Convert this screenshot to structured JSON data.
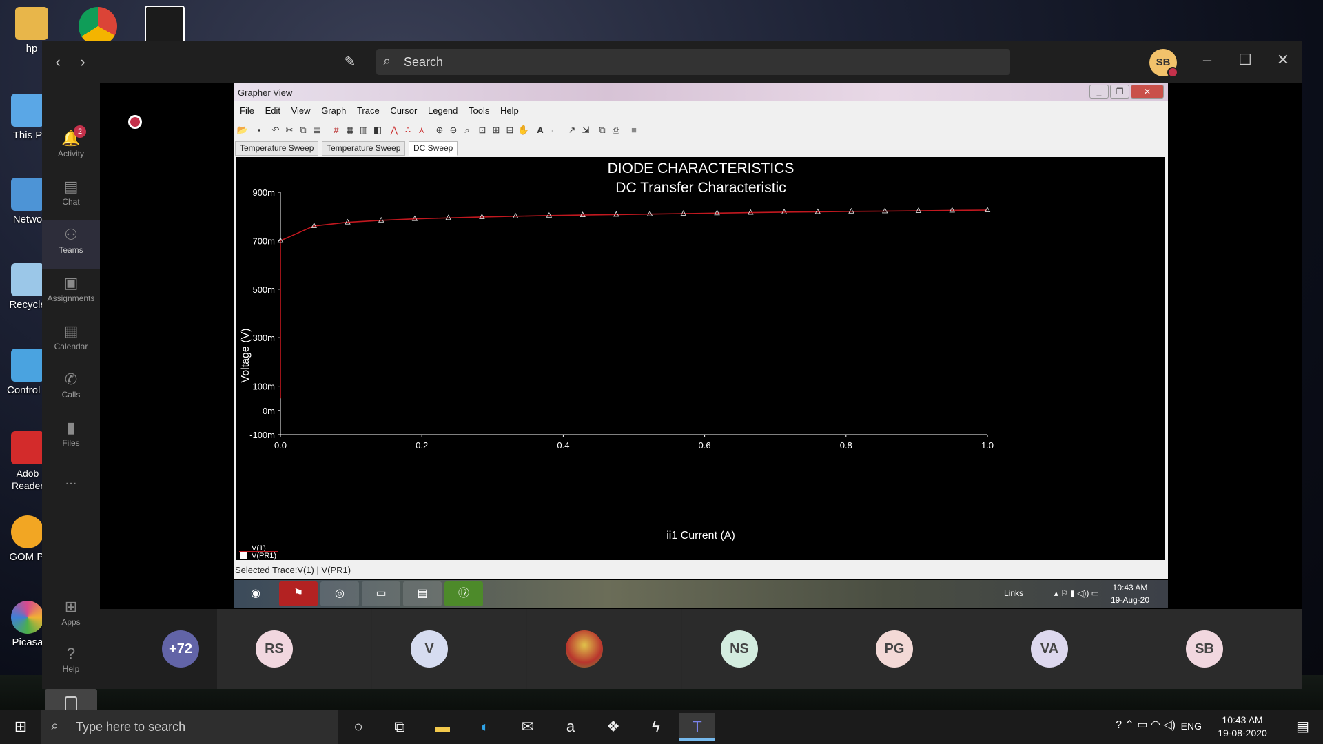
{
  "desktop": {
    "icons": [
      {
        "label": "hp",
        "icon": "folder-user-icon",
        "color": "#e8b64a"
      },
      {
        "label": "This P",
        "icon": "computer-icon",
        "color": "#5aa7e6"
      },
      {
        "label": "Netwo",
        "icon": "network-icon",
        "color": "#4d94d6"
      },
      {
        "label": "Recycle",
        "icon": "recycle-bin-icon",
        "color": "#9bc7e8"
      },
      {
        "label": "Control P",
        "icon": "control-panel-icon",
        "color": "#4aa3e0"
      },
      {
        "label": "Adob Reader",
        "icon": "adobe-reader-icon",
        "color": "#d32b2b"
      },
      {
        "label": "GOM Pl",
        "icon": "gom-player-icon",
        "color": "#f2a623"
      },
      {
        "label": "Picasa",
        "icon": "picasa-icon",
        "color": "#d94a8c"
      }
    ]
  },
  "teams": {
    "search_placeholder": "Search",
    "user_initials": "SB",
    "rail": [
      {
        "label": "Activity",
        "icon": "bell-icon",
        "badge": "2"
      },
      {
        "label": "Chat",
        "icon": "chat-icon"
      },
      {
        "label": "Teams",
        "icon": "teams-icon",
        "active": true
      },
      {
        "label": "Assignments",
        "icon": "assignments-icon"
      },
      {
        "label": "Calendar",
        "icon": "calendar-icon"
      },
      {
        "label": "Calls",
        "icon": "phone-icon"
      },
      {
        "label": "Files",
        "icon": "files-icon"
      },
      {
        "label": "...",
        "icon": "more-icon"
      },
      {
        "label": "Apps",
        "icon": "apps-icon"
      },
      {
        "label": "Help",
        "icon": "help-icon"
      }
    ],
    "participants": [
      {
        "initials": "+72",
        "color": "#6264a7",
        "text_color": "#ffffff"
      },
      {
        "initials": "RS",
        "color": "#f1d7df"
      },
      {
        "initials": "V",
        "color": "#d6dcf0"
      },
      {
        "initials": "",
        "color": "#c9a23a",
        "photo": true
      },
      {
        "initials": "NS",
        "color": "#d3ecdf"
      },
      {
        "initials": "PG",
        "color": "#f3d9d6"
      },
      {
        "initials": "VA",
        "color": "#ddd8ee"
      },
      {
        "initials": "SB",
        "color": "#f1d7df"
      }
    ]
  },
  "grapher": {
    "title": "Grapher View",
    "menu": [
      "File",
      "Edit",
      "View",
      "Graph",
      "Trace",
      "Cursor",
      "Legend",
      "Tools",
      "Help"
    ],
    "tabs": [
      "Temperature Sweep",
      "Temperature Sweep",
      "DC Sweep"
    ],
    "active_tab": 2,
    "status": "Selected Trace:V(1) | V(PR1)",
    "legend": [
      "V(1)",
      "V(PR1)"
    ]
  },
  "chart_data": {
    "type": "line",
    "title": "DIODE CHARACTERISTICS",
    "subtitle": "DC Transfer Characteristic",
    "xlabel": "ii1 Current (A)",
    "ylabel": "Voltage (V)",
    "xlim": [
      0.0,
      1.0
    ],
    "ylim": [
      -0.1,
      0.9
    ],
    "x_ticks": [
      "0.0",
      "0.2",
      "0.4",
      "0.6",
      "0.8",
      "1.0"
    ],
    "y_ticks": [
      {
        "label": "900m",
        "value": 0.9
      },
      {
        "label": "700m",
        "value": 0.7
      },
      {
        "label": "500m",
        "value": 0.5
      },
      {
        "label": "300m",
        "value": 0.3
      },
      {
        "label": "100m",
        "value": 0.1
      },
      {
        "label": "0m",
        "value": 0.0
      },
      {
        "label": "-100m",
        "value": -0.1
      }
    ],
    "series": [
      {
        "color": "#c2181f",
        "x": [
          0.0,
          0.0475,
          0.095,
          0.1425,
          0.19,
          0.2375,
          0.285,
          0.3325,
          0.38,
          0.4275,
          0.475,
          0.5225,
          0.57,
          0.6175,
          0.665,
          0.7125,
          0.76,
          0.8075,
          0.855,
          0.9025,
          0.95,
          1.0
        ],
        "y": [
          0.7,
          0.761,
          0.776,
          0.784,
          0.79,
          0.794,
          0.798,
          0.801,
          0.804,
          0.806,
          0.808,
          0.81,
          0.812,
          0.814,
          0.816,
          0.818,
          0.819,
          0.821,
          0.822,
          0.823,
          0.825,
          0.826
        ]
      }
    ],
    "grid": false
  },
  "inner_screen": {
    "tray_links": "Links",
    "clock_time": "10:43 AM",
    "clock_date": "19-Aug-20"
  },
  "taskbar": {
    "search_placeholder": "Type here to search",
    "lang": "ENG",
    "time": "10:43 AM",
    "date": "19-08-2020"
  }
}
